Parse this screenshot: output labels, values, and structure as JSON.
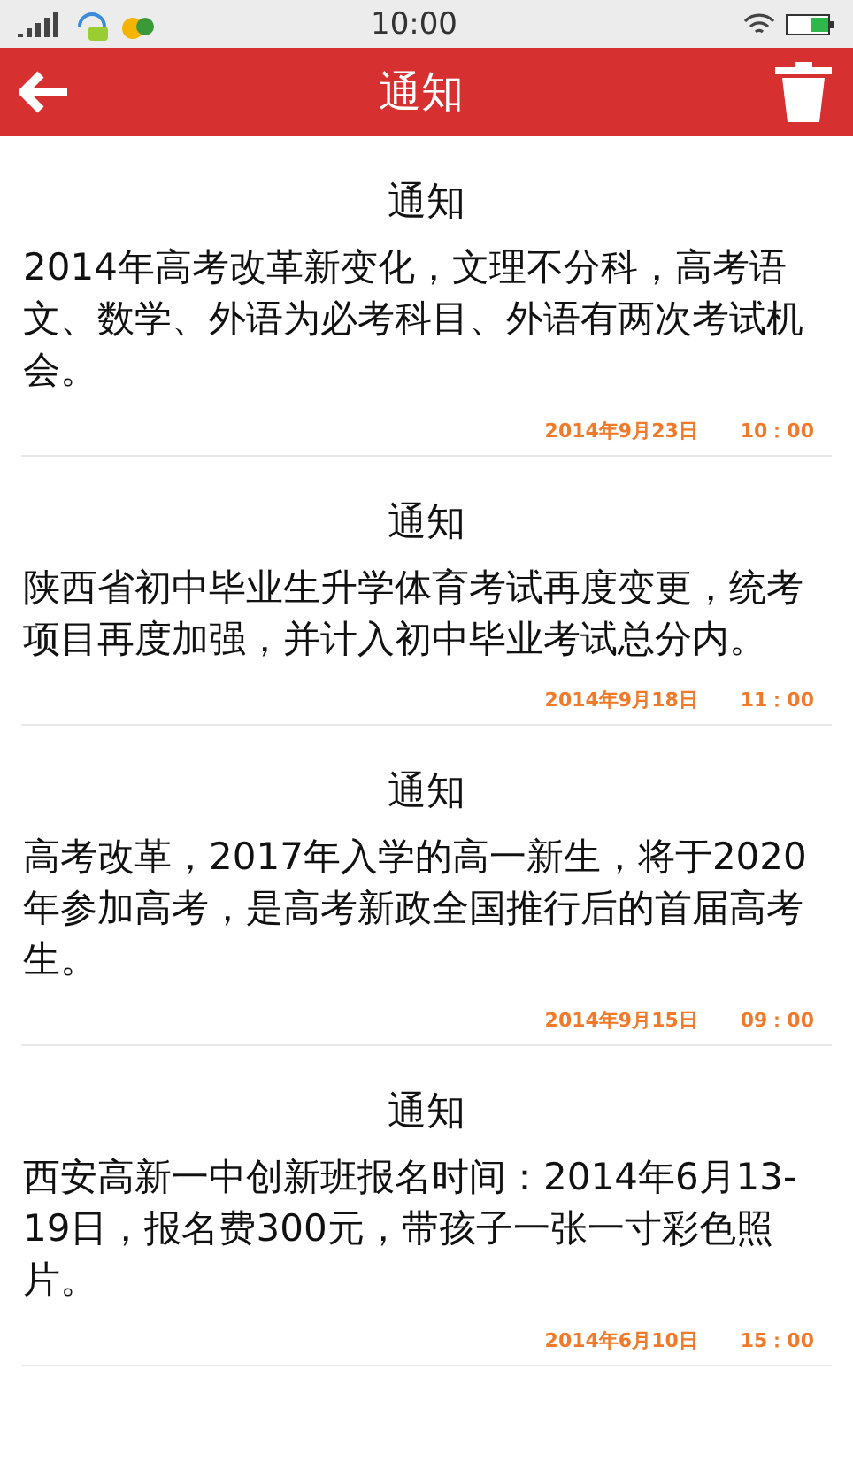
{
  "status_bar": {
    "time": "10:00"
  },
  "header": {
    "title": "通知"
  },
  "notices": [
    {
      "title": "通知",
      "body": "2014年高考改革新变化，文理不分科，高考语文、数学、外语为必考科目、外语有两次考试机会。",
      "date": "2014年9月23日",
      "time": "10：00"
    },
    {
      "title": "通知",
      "body": "陕西省初中毕业生升学体育考试再度变更，统考项目再度加强，并计入初中毕业考试总分内。",
      "date": "2014年9月18日",
      "time": "11：00"
    },
    {
      "title": "通知",
      "body": "高考改革，2017年入学的高一新生，将于2020年参加高考，是高考新政全国推行后的首届高考生。",
      "date": "2014年9月15日",
      "time": "09：00"
    },
    {
      "title": "通知",
      "body": "西安高新一中创新班报名时间：2014年6月13-19日，报名费300元，带孩子一张一寸彩色照片。",
      "date": "2014年6月10日",
      "time": "15：00"
    }
  ]
}
